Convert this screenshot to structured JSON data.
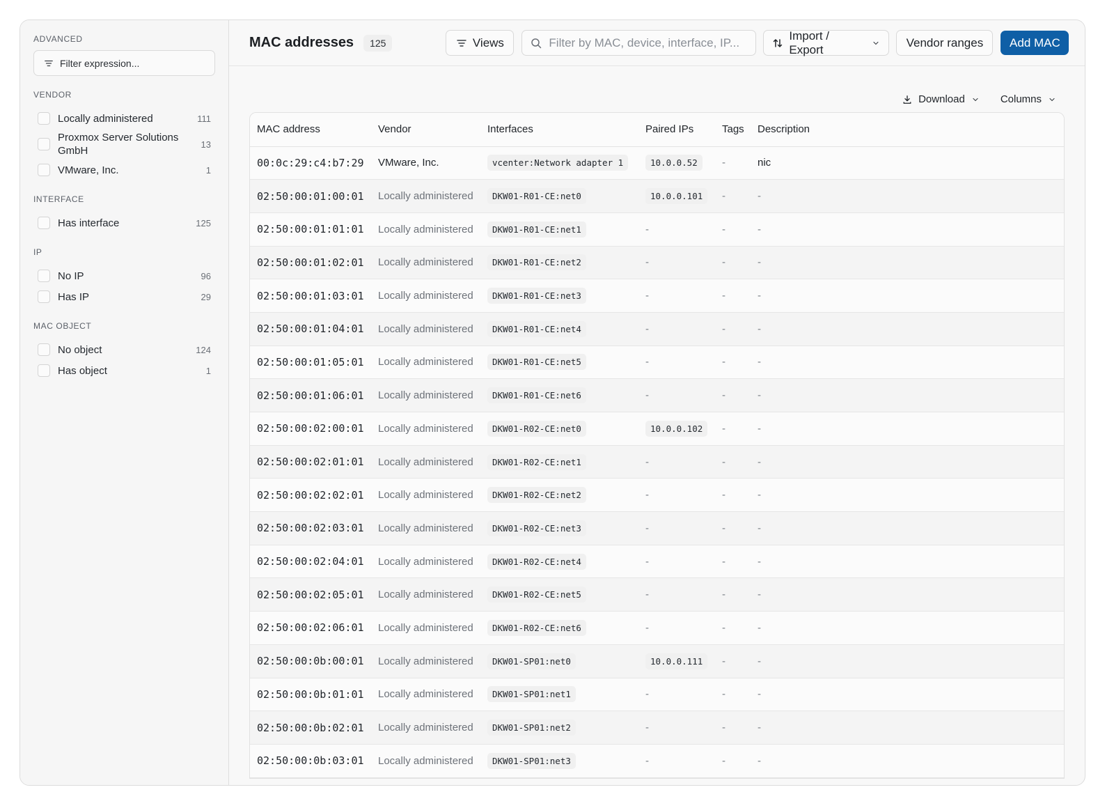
{
  "sidebar": {
    "advanced_title": "ADVANCED",
    "filter_placeholder": "Filter expression...",
    "facets": [
      {
        "title": "VENDOR",
        "items": [
          {
            "label": "Locally administered",
            "count": "111"
          },
          {
            "label": "Proxmox Server Solutions GmbH",
            "count": "13"
          },
          {
            "label": "VMware, Inc.",
            "count": "1"
          }
        ]
      },
      {
        "title": "INTERFACE",
        "items": [
          {
            "label": "Has interface",
            "count": "125"
          }
        ]
      },
      {
        "title": "IP",
        "items": [
          {
            "label": "No IP",
            "count": "96"
          },
          {
            "label": "Has IP",
            "count": "29"
          }
        ]
      },
      {
        "title": "MAC OBJECT",
        "items": [
          {
            "label": "No object",
            "count": "124"
          },
          {
            "label": "Has object",
            "count": "1"
          }
        ]
      }
    ]
  },
  "header": {
    "title": "MAC addresses",
    "count": "125",
    "views_label": "Views",
    "search_placeholder": "Filter by MAC, device, interface, IP...",
    "import_export_label": "Import / Export",
    "vendor_ranges_label": "Vendor ranges",
    "add_mac_label": "Add MAC"
  },
  "table_toolbar": {
    "download_label": "Download",
    "columns_label": "Columns"
  },
  "table": {
    "columns": [
      "MAC address",
      "Vendor",
      "Interfaces",
      "Paired IPs",
      "Tags",
      "Description"
    ],
    "rows": [
      {
        "mac": "00:0c:29:c4:b7:29",
        "vendor": "VMware, Inc.",
        "interface": "vcenter:Network adapter 1",
        "ip": "10.0.0.52",
        "tags": "-",
        "description": "nic"
      },
      {
        "mac": "02:50:00:01:00:01",
        "vendor": "Locally administered",
        "interface": "DKW01-R01-CE:net0",
        "ip": "10.0.0.101",
        "tags": "-",
        "description": "-"
      },
      {
        "mac": "02:50:00:01:01:01",
        "vendor": "Locally administered",
        "interface": "DKW01-R01-CE:net1",
        "ip": "-",
        "tags": "-",
        "description": "-"
      },
      {
        "mac": "02:50:00:01:02:01",
        "vendor": "Locally administered",
        "interface": "DKW01-R01-CE:net2",
        "ip": "-",
        "tags": "-",
        "description": "-"
      },
      {
        "mac": "02:50:00:01:03:01",
        "vendor": "Locally administered",
        "interface": "DKW01-R01-CE:net3",
        "ip": "-",
        "tags": "-",
        "description": "-"
      },
      {
        "mac": "02:50:00:01:04:01",
        "vendor": "Locally administered",
        "interface": "DKW01-R01-CE:net4",
        "ip": "-",
        "tags": "-",
        "description": "-"
      },
      {
        "mac": "02:50:00:01:05:01",
        "vendor": "Locally administered",
        "interface": "DKW01-R01-CE:net5",
        "ip": "-",
        "tags": "-",
        "description": "-"
      },
      {
        "mac": "02:50:00:01:06:01",
        "vendor": "Locally administered",
        "interface": "DKW01-R01-CE:net6",
        "ip": "-",
        "tags": "-",
        "description": "-"
      },
      {
        "mac": "02:50:00:02:00:01",
        "vendor": "Locally administered",
        "interface": "DKW01-R02-CE:net0",
        "ip": "10.0.0.102",
        "tags": "-",
        "description": "-"
      },
      {
        "mac": "02:50:00:02:01:01",
        "vendor": "Locally administered",
        "interface": "DKW01-R02-CE:net1",
        "ip": "-",
        "tags": "-",
        "description": "-"
      },
      {
        "mac": "02:50:00:02:02:01",
        "vendor": "Locally administered",
        "interface": "DKW01-R02-CE:net2",
        "ip": "-",
        "tags": "-",
        "description": "-"
      },
      {
        "mac": "02:50:00:02:03:01",
        "vendor": "Locally administered",
        "interface": "DKW01-R02-CE:net3",
        "ip": "-",
        "tags": "-",
        "description": "-"
      },
      {
        "mac": "02:50:00:02:04:01",
        "vendor": "Locally administered",
        "interface": "DKW01-R02-CE:net4",
        "ip": "-",
        "tags": "-",
        "description": "-"
      },
      {
        "mac": "02:50:00:02:05:01",
        "vendor": "Locally administered",
        "interface": "DKW01-R02-CE:net5",
        "ip": "-",
        "tags": "-",
        "description": "-"
      },
      {
        "mac": "02:50:00:02:06:01",
        "vendor": "Locally administered",
        "interface": "DKW01-R02-CE:net6",
        "ip": "-",
        "tags": "-",
        "description": "-"
      },
      {
        "mac": "02:50:00:0b:00:01",
        "vendor": "Locally administered",
        "interface": "DKW01-SP01:net0",
        "ip": "10.0.0.111",
        "tags": "-",
        "description": "-"
      },
      {
        "mac": "02:50:00:0b:01:01",
        "vendor": "Locally administered",
        "interface": "DKW01-SP01:net1",
        "ip": "-",
        "tags": "-",
        "description": "-"
      },
      {
        "mac": "02:50:00:0b:02:01",
        "vendor": "Locally administered",
        "interface": "DKW01-SP01:net2",
        "ip": "-",
        "tags": "-",
        "description": "-"
      },
      {
        "mac": "02:50:00:0b:03:01",
        "vendor": "Locally administered",
        "interface": "DKW01-SP01:net3",
        "ip": "-",
        "tags": "-",
        "description": "-"
      }
    ]
  },
  "colors": {
    "accent": "#0f5fa6",
    "border": "#dcdcdc",
    "muted_text": "#6d7279"
  },
  "icons": {
    "filter": "filter-lines-icon",
    "search": "search-icon",
    "sort": "sort-arrows-icon",
    "chevron": "chevron-down-icon",
    "download": "download-icon"
  }
}
